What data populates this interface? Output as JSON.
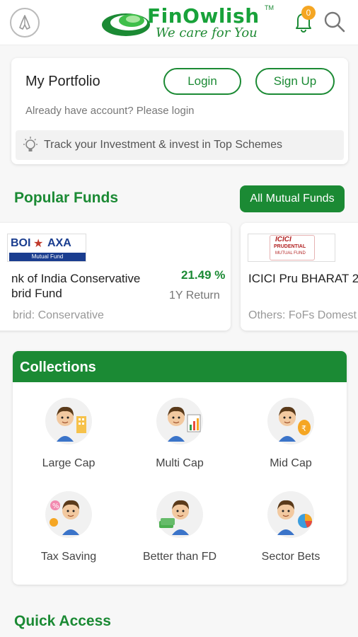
{
  "header": {
    "logo_title": "FinOwlish",
    "logo_trademark": "TM",
    "logo_tagline": "We care for You",
    "notification_count": "0",
    "icons": {
      "menu": "pray-hands-icon",
      "bell": "bell-icon",
      "search": "search-icon"
    },
    "brand_color": "#1b8a34",
    "badge_color": "#f5a623"
  },
  "portfolio": {
    "title": "My Portfolio",
    "login_label": "Login",
    "signup_label": "Sign Up",
    "subtitle": "Already have account? Please login",
    "track_text": "Track your Investment & invest in Top Schemes"
  },
  "popular_funds": {
    "title": "Popular Funds",
    "all_button": "All Mutual Funds",
    "funds": [
      {
        "logo_text": "BOI",
        "logo_brand": "AXA",
        "logo_sub": "Mutual Fund",
        "name_line1": "nk of India Conservative",
        "name_line2": "brid Fund",
        "return_value": "21.49 %",
        "return_label": "1Y Return",
        "category": "brid: Conservative"
      },
      {
        "logo_text": "ICICI",
        "logo_brand": "PRUDENTIAL",
        "logo_sub": "MUTUAL FUND",
        "name_line1": "ICICI Pru BHARAT 2",
        "category": "Others: FoFs Domest"
      }
    ]
  },
  "collections": {
    "title": "Collections",
    "items": [
      {
        "label": "Large Cap",
        "icon": "large-cap-icon"
      },
      {
        "label": "Multi Cap",
        "icon": "multi-cap-icon"
      },
      {
        "label": "Mid Cap",
        "icon": "mid-cap-icon"
      },
      {
        "label": "Tax Saving",
        "icon": "tax-saving-icon"
      },
      {
        "label": "Better than FD",
        "icon": "better-than-fd-icon"
      },
      {
        "label": "Sector Bets",
        "icon": "sector-bets-icon"
      }
    ]
  },
  "quick_access": {
    "title": "Quick Access"
  }
}
